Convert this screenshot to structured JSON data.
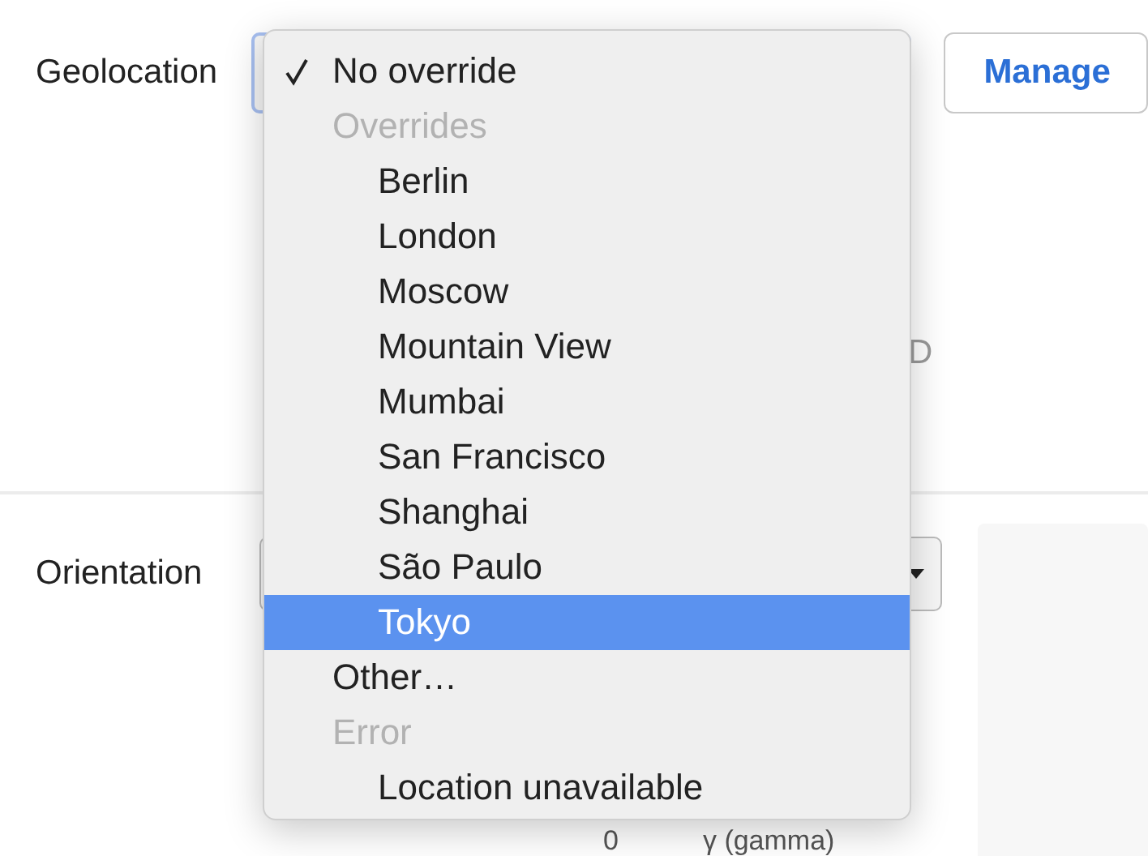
{
  "geolocation": {
    "label": "Geolocation",
    "manage_button": "Manage",
    "partial_text": "D"
  },
  "orientation": {
    "label": "Orientation",
    "readings": [
      "0",
      "γ (gamma)"
    ]
  },
  "menu": {
    "items": [
      {
        "kind": "option",
        "label": "No override",
        "checked": true,
        "selected": false
      },
      {
        "kind": "group",
        "label": "Overrides",
        "children": [
          {
            "label": "Berlin",
            "checked": false,
            "selected": false
          },
          {
            "label": "London",
            "checked": false,
            "selected": false
          },
          {
            "label": "Moscow",
            "checked": false,
            "selected": false
          },
          {
            "label": "Mountain View",
            "checked": false,
            "selected": false
          },
          {
            "label": "Mumbai",
            "checked": false,
            "selected": false
          },
          {
            "label": "San Francisco",
            "checked": false,
            "selected": false
          },
          {
            "label": "Shanghai",
            "checked": false,
            "selected": false
          },
          {
            "label": "São Paulo",
            "checked": false,
            "selected": false
          },
          {
            "label": "Tokyo",
            "checked": false,
            "selected": true
          }
        ]
      },
      {
        "kind": "option",
        "label": "Other…",
        "checked": false,
        "selected": false
      },
      {
        "kind": "group",
        "label": "Error",
        "children": [
          {
            "label": "Location unavailable",
            "checked": false,
            "selected": false
          }
        ]
      }
    ]
  }
}
